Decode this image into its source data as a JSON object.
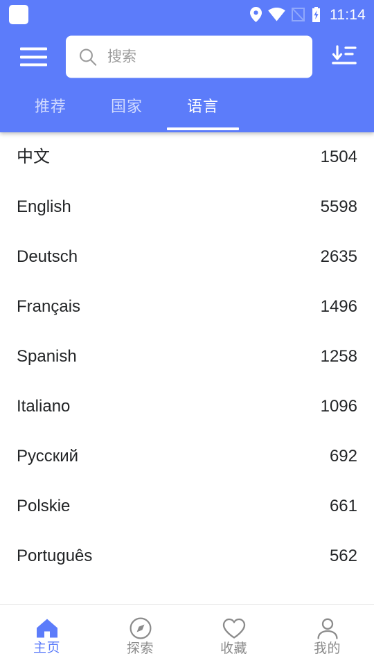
{
  "theme": {
    "primary": "#5c7cfa",
    "active_nav": "#5c7cfa",
    "text": "#222426",
    "muted_text": "#8b8b8b",
    "placeholder": "#9a9a9a"
  },
  "status_bar": {
    "time": "11:14",
    "icons": [
      "notification-square-icon",
      "location-icon",
      "wifi-icon",
      "no-sim-icon",
      "battery-charging-icon"
    ]
  },
  "appbar": {
    "menu_icon": "hamburger-menu-icon",
    "sort_icon": "sort-descending-icon",
    "search": {
      "icon": "search-icon",
      "value": "",
      "placeholder": "搜索"
    }
  },
  "tabs": {
    "active_index": 2,
    "items": [
      {
        "label": "推荐"
      },
      {
        "label": "国家"
      },
      {
        "label": "语言"
      }
    ]
  },
  "list": {
    "rows": [
      {
        "name": "中文",
        "count": "1504"
      },
      {
        "name": "English",
        "count": "5598"
      },
      {
        "name": "Deutsch",
        "count": "2635"
      },
      {
        "name": "Français",
        "count": "1496"
      },
      {
        "name": "Spanish",
        "count": "1258"
      },
      {
        "name": "Italiano",
        "count": "1096"
      },
      {
        "name": "Русский",
        "count": "692"
      },
      {
        "name": "Polskie",
        "count": "661"
      },
      {
        "name": "Português",
        "count": "562"
      }
    ]
  },
  "bottom_nav": {
    "active_index": 0,
    "items": [
      {
        "label": "主页",
        "icon": "home-icon"
      },
      {
        "label": "探索",
        "icon": "compass-icon"
      },
      {
        "label": "收藏",
        "icon": "heart-icon"
      },
      {
        "label": "我的",
        "icon": "person-icon"
      }
    ]
  }
}
